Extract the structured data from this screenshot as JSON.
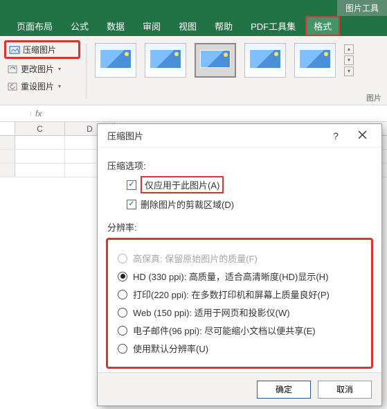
{
  "titlebar": {
    "tool_tab": "图片工具"
  },
  "ribbon_tabs": {
    "items": [
      "页面布局",
      "公式",
      "数据",
      "审阅",
      "视图",
      "帮助",
      "PDF工具集",
      "格式"
    ],
    "active_index": 7
  },
  "ribbon_buttons": {
    "compress": "压缩图片",
    "change": "更改图片",
    "reset": "重设图片"
  },
  "ribbon_group_label": "图片",
  "formula": {
    "fx": "fx"
  },
  "columns": [
    "",
    "C",
    "D"
  ],
  "dialog": {
    "title": "压缩图片",
    "section_options": "压缩选项:",
    "opt_apply_only": "仅应用于此图片(A)",
    "opt_delete_crop": "删除图片的剪裁区域(D)",
    "section_resolution": "分辨率:",
    "res": [
      {
        "label": "高保真: 保留原始图片的质量(F)",
        "disabled": true,
        "checked": false
      },
      {
        "label": "HD (330 ppi): 高质量，适合高清晰度(HD)显示(H)",
        "disabled": false,
        "checked": true
      },
      {
        "label": "打印(220 ppi): 在多数打印机和屏幕上质量良好(P)",
        "disabled": false,
        "checked": false
      },
      {
        "label": "Web (150 ppi): 适用于网页和投影仪(W)",
        "disabled": false,
        "checked": false
      },
      {
        "label": "电子邮件(96 ppi): 尽可能缩小文档以便共享(E)",
        "disabled": false,
        "checked": false
      },
      {
        "label": "使用默认分辨率(U)",
        "disabled": false,
        "checked": false
      }
    ],
    "ok": "确定",
    "cancel": "取消",
    "help": "?"
  }
}
